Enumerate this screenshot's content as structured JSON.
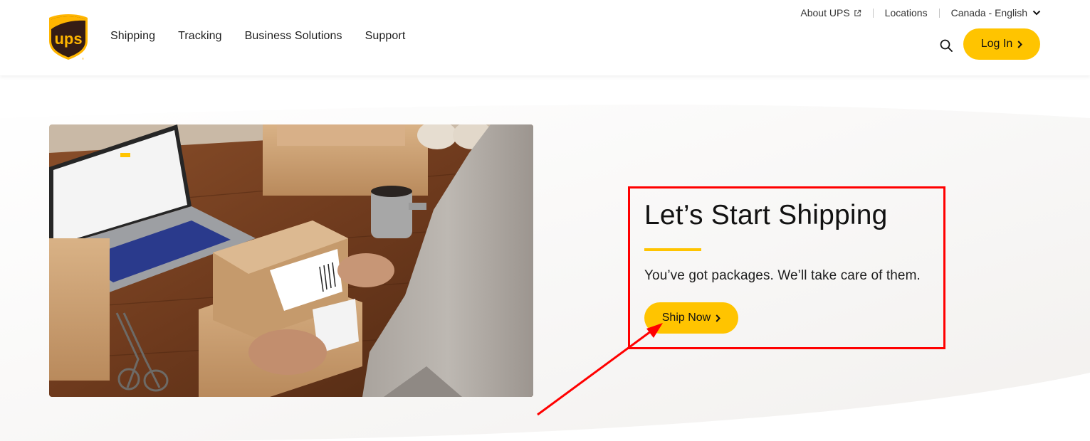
{
  "brand": {
    "logo_text": "ups",
    "colors": {
      "brown": "#351c15",
      "gold": "#ffb500",
      "accent_yellow": "#ffc400",
      "annotation_red": "#ff0000"
    }
  },
  "header": {
    "primary_nav": [
      {
        "label": "Shipping"
      },
      {
        "label": "Tracking"
      },
      {
        "label": "Business Solutions"
      },
      {
        "label": "Support"
      }
    ],
    "utility_nav": {
      "about": {
        "label": "About UPS",
        "icon": "external-link-icon"
      },
      "locations": {
        "label": "Locations"
      },
      "locale": {
        "label": "Canada - English",
        "icon": "chevron-down-icon"
      }
    },
    "search": {
      "icon": "search-icon"
    },
    "login": {
      "label": "Log In",
      "icon": "chevron-right-icon"
    }
  },
  "hero": {
    "image_alt": "Person preparing labeled cardboard packages at a wooden desk with a laptop",
    "title": "Let’s Start Shipping",
    "subtitle": "You’ve got packages. We’ll take care of them.",
    "cta": {
      "label": "Ship Now",
      "icon": "chevron-right-icon"
    }
  },
  "annotation": {
    "type": "highlight-box-with-arrow",
    "target": "Ship Now"
  }
}
